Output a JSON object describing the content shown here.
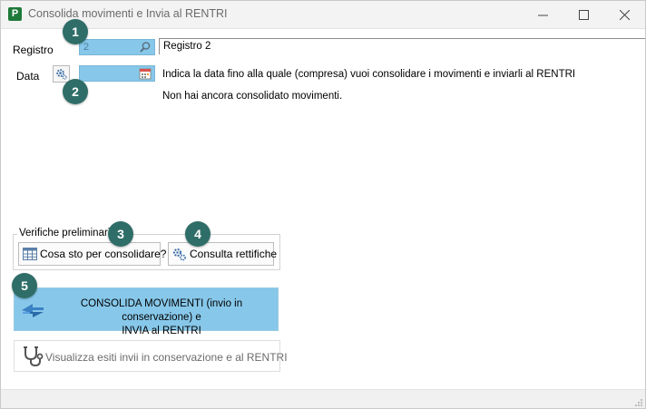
{
  "window": {
    "title": "Consolida movimenti e Invia al RENTRI",
    "app_icon_letter": "P",
    "min_glyph": "—",
    "max_glyph": "☐",
    "close_glyph": "✕"
  },
  "form": {
    "registro_label": "Registro",
    "registro_value": "2",
    "registro_description": "Registro 2",
    "data_label": "Data",
    "data_value": "",
    "info_line1": "Indica la data fino alla quale (compresa) vuoi consolidare i movimenti e inviarli al RENTRI",
    "info_line2": "Non hai ancora consolidato movimenti."
  },
  "verifiche": {
    "legend": "Verifiche preliminari",
    "cosa_label": "Cosa sto per consolidare?",
    "rettifiche_label": "Consulta rettifiche"
  },
  "consolida": {
    "line1": "CONSOLIDA MOVIMENTI (invio in conservazione) e",
    "line2": "INVIA al RENTRI"
  },
  "esiti": {
    "label": "Visualizza esiti invii in conservazione e al RENTRI"
  },
  "badges": [
    "1",
    "2",
    "3",
    "4",
    "5"
  ],
  "colors": {
    "field_blue": "#87c8ea",
    "badge": "#2f6e68",
    "app_icon": "#1f7a3a"
  },
  "icons": {
    "search": "search-icon",
    "calendar": "calendar-icon",
    "gear": "gear-icon",
    "table": "table-icon",
    "gears": "gears-icon",
    "send": "send-arrows-icon",
    "stethoscope": "stethoscope-icon"
  }
}
